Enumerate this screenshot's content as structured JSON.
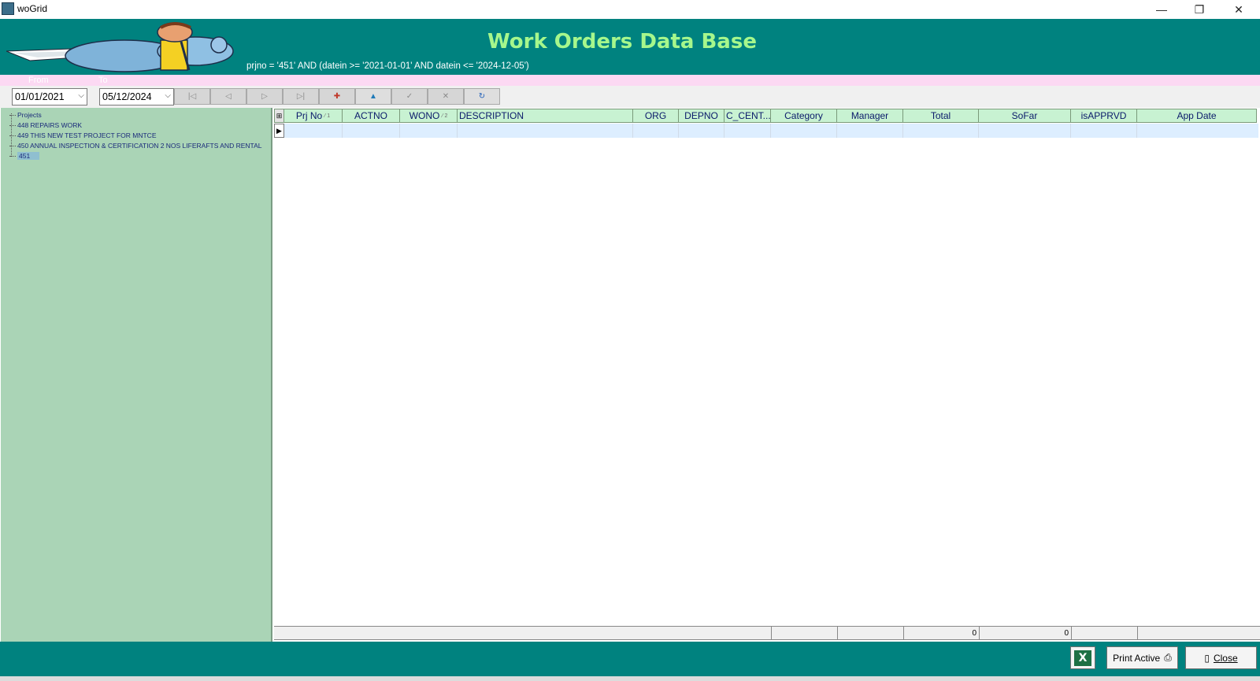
{
  "window": {
    "title": "woGrid",
    "minimize": "—",
    "restore": "❐",
    "close": "✕"
  },
  "header": {
    "title": "Work Orders Data Base",
    "filter": "prjno = '451' AND (datein >= '2021-01-01' AND datein <= '2024-12-05')"
  },
  "filter_labels": {
    "from": "From",
    "to": "To"
  },
  "dates": {
    "from_value": "01/01/2021",
    "to_value": "05/12/2024"
  },
  "navigator": {
    "first": "|◁",
    "prior": "◁",
    "next": "▷",
    "last": "▷|",
    "insert": "✚",
    "edit": "▲",
    "post": "✓",
    "cancel": "✕",
    "refresh": "↻",
    "colors": {
      "insert": "#c0392b",
      "edit": "#1f7ab8",
      "refresh": "#1f5fb8"
    }
  },
  "tree": {
    "root": "Projects",
    "items": [
      {
        "label": "448  REPAIRS WORK"
      },
      {
        "label": "449  THIS NEW TEST PROJECT FOR MNTCE"
      },
      {
        "label": "450  ANNUAL INSPECTION & CERTIFICATION 2 NOS LIFERAFTS AND RENTAL"
      },
      {
        "label": "451"
      }
    ]
  },
  "grid": {
    "columns": [
      {
        "label": "Prj No",
        "sort": "⁄ 1"
      },
      {
        "label": "ACTNO",
        "sort": ""
      },
      {
        "label": "WONO",
        "sort": "⁄ 2"
      },
      {
        "label": "DESCRIPTION",
        "sort": ""
      },
      {
        "label": "ORG",
        "sort": ""
      },
      {
        "label": "DEPNO",
        "sort": ""
      },
      {
        "label": "C_CENT...",
        "sort": ""
      },
      {
        "label": "Category",
        "sort": ""
      },
      {
        "label": "Manager",
        "sort": ""
      },
      {
        "label": "Total",
        "sort": ""
      },
      {
        "label": "SoFar",
        "sort": ""
      },
      {
        "label": "isAPPRVD",
        "sort": ""
      },
      {
        "label": "App Date",
        "sort": ""
      }
    ],
    "totals": {
      "total": "0",
      "sofar": "0"
    }
  },
  "buttons": {
    "excel_icon": "X",
    "print_active": "Print Active",
    "close": "Close"
  },
  "colors": {
    "header_bg": "#00827f",
    "title_green": "#a6f78c",
    "tree_bg": "#aad4b6",
    "column_header_bg": "#c8f2d2",
    "pink_strip": "#fcd9f3"
  }
}
